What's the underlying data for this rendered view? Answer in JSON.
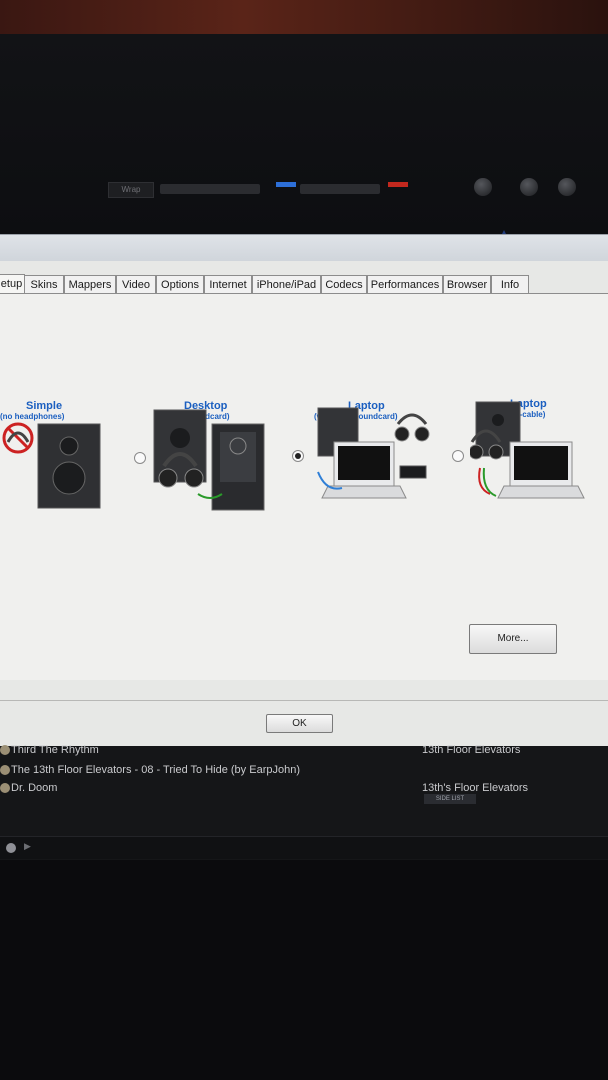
{
  "app": {
    "toolbar_label": "Wrap",
    "tabs": [
      {
        "label": "etup"
      },
      {
        "label": "Skins"
      },
      {
        "label": "Mappers"
      },
      {
        "label": "Video"
      },
      {
        "label": "Options"
      },
      {
        "label": "Internet"
      },
      {
        "label": "iPhone/iPad"
      },
      {
        "label": "Codecs"
      },
      {
        "label": "Performances"
      },
      {
        "label": "Browser"
      },
      {
        "label": "Info"
      }
    ],
    "options": [
      {
        "title": "Simple",
        "subtitle": "(no headphones)",
        "selected": false
      },
      {
        "title": "Desktop",
        "subtitle": "(4.1 soundcard)",
        "selected": false
      },
      {
        "title": "Laptop",
        "subtitle": "(with USB soundcard)",
        "selected": true
      },
      {
        "title": "Laptop",
        "subtitle": "(with Y-cable)",
        "selected": false
      }
    ],
    "more_button": "More...",
    "ok_button": "OK"
  },
  "tracklist": {
    "rows": [
      {
        "title": "Third The Rhythm",
        "artist": "13th Floor Elevators"
      },
      {
        "title": "The 13th Floor Elevators - 08 - Tried To Hide (by EarpJohn)",
        "artist": ""
      },
      {
        "title": "Dr. Doom",
        "artist": "13th's Floor Elevators"
      }
    ],
    "side_list_label": "SIDE LIST"
  },
  "colors": {
    "accent": "#1b5fc0",
    "deck_left": "#2d6fd8",
    "deck_right": "#c2281e"
  }
}
